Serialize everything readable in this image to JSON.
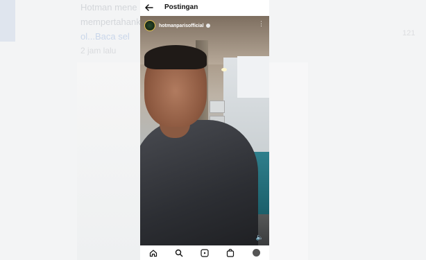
{
  "header": {
    "title": "Postingan"
  },
  "post": {
    "username": "hotmanparisofficial"
  },
  "background": {
    "lines": [
      "Hotman mene              bersalah. Terana",
      "mempertahank          lelat yang diambil diam-diam",
      "ol...Baca sel"
    ],
    "meta": "2 jam lalu",
    "count": "121"
  },
  "icons": {
    "back": "arrow-left-icon",
    "more": "more-vertical-icon",
    "sound": "speaker-icon",
    "verified": "verified-badge-icon",
    "nav": [
      "home-icon",
      "search-icon",
      "reels-icon",
      "shop-icon",
      "profile-avatar"
    ]
  }
}
